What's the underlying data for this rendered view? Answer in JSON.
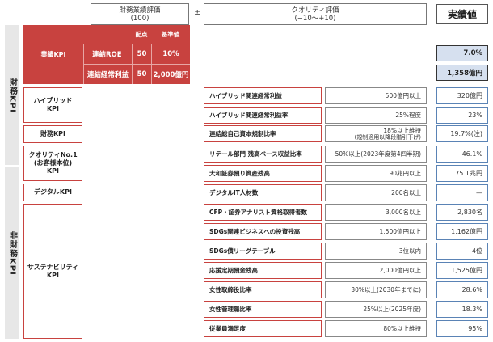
{
  "header": {
    "financial_eval_line1": "財務業績評価",
    "financial_eval_line2": "(100)",
    "plus_minus": "±",
    "quality_eval_line1": "クオリティ評価",
    "quality_eval_line2": "(−10〜+10)",
    "actual_label": "実績値"
  },
  "side": {
    "financial": "財務KPI",
    "non_financial": "非財務KPI"
  },
  "performance_kpi": {
    "label": "業績KPI",
    "col_weight": "配点",
    "col_base": "基準値",
    "rows": [
      {
        "name": "連結ROE",
        "weight": "50",
        "base": "10%",
        "actual": "7.0%"
      },
      {
        "name": "連結経常利益",
        "weight": "50",
        "base": "2,000億円",
        "actual": "1,358億円"
      }
    ]
  },
  "categories": {
    "hybrid_line1": "ハイブリッド",
    "hybrid_line2": "KPI",
    "financial": "財務KPI",
    "quality_line1": "クオリティNo.1",
    "quality_line2": "(お客様本位)",
    "quality_line3": "KPI",
    "digital": "デジタルKPI",
    "sustain_line1": "サステナビリティ",
    "sustain_line2": "KPI"
  },
  "kpis": [
    {
      "name": "ハイブリッド関連経常利益",
      "target": "500億円以上",
      "target2": "",
      "actual": "320億円"
    },
    {
      "name": "ハイブリッド関連経常利益率",
      "target": "25%程度",
      "target2": "",
      "actual": "23%"
    },
    {
      "name": "連結総自己資本規制比率",
      "target": "18%以上維持",
      "target2": "(規制適用以降段階引下げ)",
      "actual": "19.7%(注)"
    },
    {
      "name": "リテール部門 残高ベース収益比率",
      "target": "50%以上(2023年度第4四半期)",
      "target2": "",
      "actual": "46.1%"
    },
    {
      "name": "大和証券預り資産残高",
      "target": "90兆円以上",
      "target2": "",
      "actual": "75.1兆円"
    },
    {
      "name": "デジタルIT人材数",
      "target": "200名以上",
      "target2": "",
      "actual": "—"
    },
    {
      "name": "CFP・証券アナリスト資格取得者数",
      "target": "3,000名以上",
      "target2": "",
      "actual": "2,830名"
    },
    {
      "name": "SDGs関連ビジネスへの投資残高",
      "target": "1,500億円以上",
      "target2": "",
      "actual": "1,162億円"
    },
    {
      "name": "SDGs債リーグテーブル",
      "target": "3位以内",
      "target2": "",
      "actual": "4位"
    },
    {
      "name": "応援定期預金残高",
      "target": "2,000億円以上",
      "target2": "",
      "actual": "1,525億円"
    },
    {
      "name": "女性取締役比率",
      "target": "30%以上(2030年までに)",
      "target2": "",
      "actual": "28.6%"
    },
    {
      "name": "女性管理職比率",
      "target": "25%以上(2025年度)",
      "target2": "",
      "actual": "18.3%"
    },
    {
      "name": "従業員満足度",
      "target": "80%以上維持",
      "target2": "",
      "actual": "95%"
    }
  ]
}
